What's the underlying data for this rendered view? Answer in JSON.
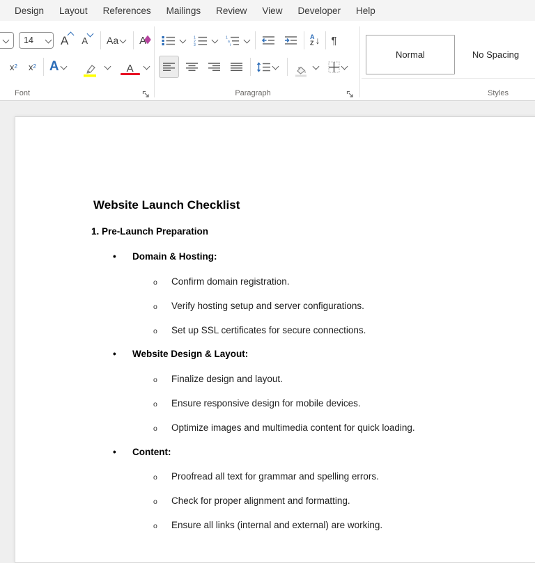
{
  "tabs": [
    "Design",
    "Layout",
    "References",
    "Mailings",
    "Review",
    "View",
    "Developer",
    "Help"
  ],
  "font_group": {
    "label": "Font",
    "size_value": "14",
    "grow_letter": "A",
    "shrink_letter": "A",
    "change_case": "Aa",
    "clear_letter": "A",
    "sub_base": "x",
    "sub_digit": "2",
    "sup_base": "x",
    "sup_digit": "2",
    "effects_letter": "A",
    "color_letter": "A"
  },
  "paragraph_group": {
    "label": "Paragraph",
    "sort_a": "A",
    "sort_z": "Z",
    "sort_arrow": "↓",
    "pilcrow": "¶"
  },
  "styles_group": {
    "label": "Styles",
    "styles": [
      {
        "name": "Normal",
        "selected": true
      },
      {
        "name": "No Spacing",
        "selected": false
      }
    ]
  },
  "colors": {
    "accent_blue": "#2b6cb8",
    "highlight_yellow": "#ffff00",
    "font_color_red": "#e81123",
    "eraser_magenta": "#b5429e"
  },
  "document": {
    "title": "Website Launch Checklist",
    "section": "1. Pre-Launch Preparation",
    "bullet_marker": "•",
    "sub_marker": "o",
    "groups": [
      {
        "heading": "Domain & Hosting:",
        "items": [
          "Confirm domain registration.",
          "Verify hosting setup and server configurations.",
          "Set up SSL certificates for secure connections."
        ]
      },
      {
        "heading": "Website Design & Layout:",
        "items": [
          "Finalize design and layout.",
          "Ensure responsive design for mobile devices.",
          "Optimize images and multimedia content for quick loading."
        ]
      },
      {
        "heading": "Content:",
        "items": [
          "Proofread all text for grammar and spelling errors.",
          "Check for proper alignment and formatting.",
          "Ensure all links (internal and external) are working."
        ]
      }
    ]
  }
}
